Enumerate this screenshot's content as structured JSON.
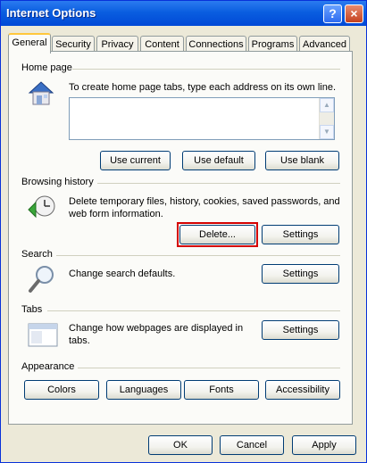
{
  "window": {
    "title": "Internet Options",
    "help_label": "?",
    "close_label": "×"
  },
  "tabs": [
    {
      "label": "General"
    },
    {
      "label": "Security"
    },
    {
      "label": "Privacy"
    },
    {
      "label": "Content"
    },
    {
      "label": "Connections"
    },
    {
      "label": "Programs"
    },
    {
      "label": "Advanced"
    }
  ],
  "home_page": {
    "heading": "Home page",
    "description": "To create home page tabs, type each address on its own line.",
    "textarea_value": "",
    "buttons": {
      "use_current": "Use current",
      "use_default": "Use default",
      "use_blank": "Use blank"
    }
  },
  "browsing_history": {
    "heading": "Browsing history",
    "description": "Delete temporary files, history, cookies, saved passwords, and web form information.",
    "delete_label": "Delete...",
    "settings_label": "Settings"
  },
  "search": {
    "heading": "Search",
    "description": "Change search defaults.",
    "settings_label": "Settings"
  },
  "tabs_section": {
    "heading": "Tabs",
    "description": "Change how webpages are displayed in tabs.",
    "settings_label": "Settings"
  },
  "appearance": {
    "heading": "Appearance",
    "buttons": {
      "colors": "Colors",
      "languages": "Languages",
      "fonts": "Fonts",
      "accessibility": "Accessibility"
    }
  },
  "footer": {
    "ok": "OK",
    "cancel": "Cancel",
    "apply": "Apply"
  },
  "colors": {
    "highlight": "#d40000",
    "titlebar": "#0a5ee0"
  }
}
